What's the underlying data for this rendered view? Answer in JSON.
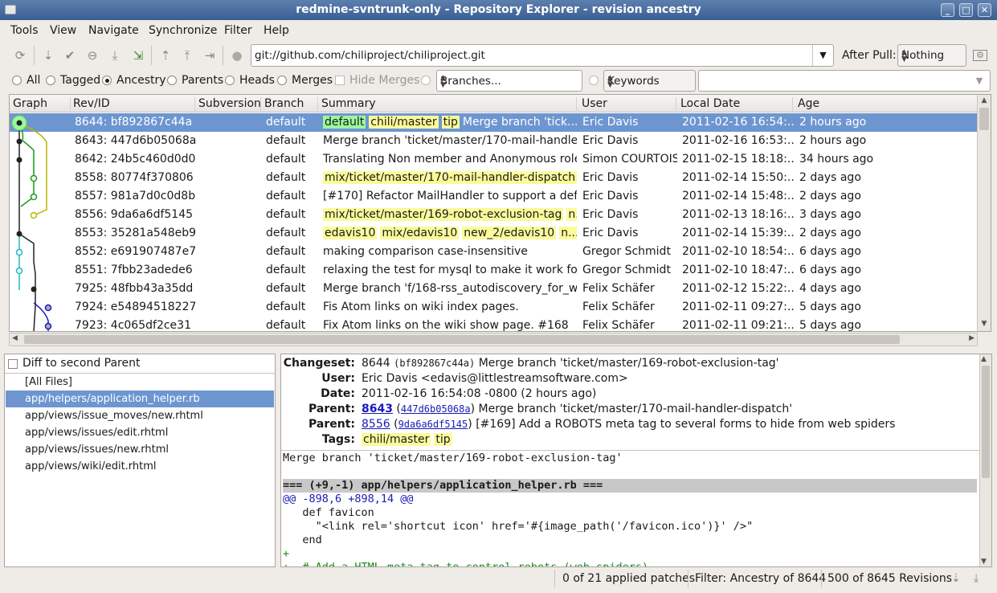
{
  "window": {
    "title": "redmine-svntrunk-only - Repository Explorer - revision ancestry",
    "min": "_",
    "max": "□",
    "close": "✕"
  },
  "menu": [
    "Tools",
    "View",
    "Navigate",
    "Synchronize",
    "Filter",
    "Help"
  ],
  "toolbar": {
    "url": "git://github.com/chiliproject/chiliproject.git",
    "after_pull_label": "After Pull:",
    "after_pull_value": "Nothing"
  },
  "filters": {
    "all": "All",
    "tagged": "Tagged",
    "ancestry": "Ancestry",
    "parents": "Parents",
    "heads": "Heads",
    "merges": "Merges",
    "hide_merges": "Hide Merges",
    "branches": "Branches...",
    "keywords": "Keywords",
    "selected_filter": "Ancestry"
  },
  "columns": [
    "Graph",
    "Rev/ID",
    "Subversion",
    "Branch",
    "Summary",
    "User",
    "Local Date",
    "Age"
  ],
  "rows": [
    {
      "rev": "8644: bf892867c44a",
      "branch": "default",
      "tags": [
        {
          "t": "default",
          "c": "g"
        },
        {
          "t": "chili/master",
          "c": "y"
        },
        {
          "t": "tip",
          "c": "y"
        }
      ],
      "summary": "Merge branch 'tick...",
      "user": "Eric Davis",
      "date": "2011-02-16 16:54:...",
      "age": "2 hours ago",
      "sel": true
    },
    {
      "rev": "8643: 447d6b05068a",
      "branch": "default",
      "tags": [],
      "summary": "Merge branch 'ticket/master/170-mail-handler...",
      "user": "Eric Davis",
      "date": "2011-02-16 16:53:...",
      "age": "2 hours ago"
    },
    {
      "rev": "8642: 24b5c460d0d0",
      "branch": "default",
      "tags": [],
      "summary": "Translating Non member and Anonymous role...",
      "user": "Simon COURTOIS",
      "date": "2011-02-15 18:18:...",
      "age": "34 hours ago"
    },
    {
      "rev": "8558: 80774f370806",
      "branch": "default",
      "tags": [
        {
          "t": "mix/ticket/master/170-mail-handler-dispatch ...",
          "c": "y"
        }
      ],
      "summary": "",
      "user": "Eric Davis",
      "date": "2011-02-14 15:50:...",
      "age": "2 days ago"
    },
    {
      "rev": "8557: 981a7d0c0d8b",
      "branch": "default",
      "tags": [],
      "summary": "[#170] Refactor MailHandler to support a defa...",
      "user": "Eric Davis",
      "date": "2011-02-14 15:48:...",
      "age": "2 days ago"
    },
    {
      "rev": "8556: 9da6a6df5145",
      "branch": "default",
      "tags": [
        {
          "t": "mix/ticket/master/169-robot-exclusion-tag",
          "c": "y"
        },
        {
          "t": "n...",
          "c": "y"
        }
      ],
      "summary": "",
      "user": "Eric Davis",
      "date": "2011-02-13 18:16:...",
      "age": "3 days ago"
    },
    {
      "rev": "8553: 35281a548eb9",
      "branch": "default",
      "tags": [
        {
          "t": "edavis10",
          "c": "y"
        },
        {
          "t": "mix/edavis10",
          "c": "y"
        },
        {
          "t": "new_2/edavis10",
          "c": "y"
        },
        {
          "t": "n...",
          "c": "y"
        }
      ],
      "summary": "",
      "user": "Eric Davis",
      "date": "2011-02-14 15:39:...",
      "age": "2 days ago"
    },
    {
      "rev": "8552: e691907487e7",
      "branch": "default",
      "tags": [],
      "summary": "making comparison case-insensitive",
      "user": "Gregor Schmidt",
      "date": "2011-02-10 18:54:...",
      "age": "6 days ago"
    },
    {
      "rev": "8551: 7fbb23adede6",
      "branch": "default",
      "tags": [],
      "summary": "relaxing the test for mysql to make it work fo...",
      "user": "Gregor Schmidt",
      "date": "2011-02-10 18:47:...",
      "age": "6 days ago"
    },
    {
      "rev": "7925: 48fbb43a35dd",
      "branch": "default",
      "tags": [],
      "summary": "Merge branch 'f/168-rss_autodiscovery_for_wi...",
      "user": "Felix Schäfer",
      "date": "2011-02-12 15:22:...",
      "age": "4 days ago"
    },
    {
      "rev": "7924: e54894518227",
      "branch": "default",
      "tags": [],
      "summary": "Fis Atom links on wiki index pages.",
      "user": "Felix Schäfer",
      "date": "2011-02-11 09:27:...",
      "age": "5 days ago"
    },
    {
      "rev": "7923: 4c065df2ce31",
      "branch": "default",
      "tags": [],
      "summary": "Fix Atom links on the wiki show page. #168",
      "user": "Felix Schäfer",
      "date": "2011-02-11 09:21:...",
      "age": "5 days ago"
    }
  ],
  "files": {
    "diff_label": "Diff to second Parent",
    "items": [
      "[All Files]",
      "app/helpers/application_helper.rb",
      "app/views/issue_moves/new.rhtml",
      "app/views/issues/edit.rhtml",
      "app/views/issues/new.rhtml",
      "app/views/wiki/edit.rhtml"
    ],
    "selected": 1
  },
  "detail": {
    "changeset_label": "Changeset:",
    "changeset_rev": "8644",
    "changeset_hash": "(bf892867c44a)",
    "changeset_msg": "Merge branch 'ticket/master/169-robot-exclusion-tag'",
    "user_label": "User:",
    "user": "Eric Davis <edavis@littlestreamsoftware.com>",
    "date_label": "Date:",
    "date": "2011-02-16 16:54:08 -0800 (2 hours ago)",
    "parent1_label": "Parent:",
    "parent1_rev": "8643",
    "parent1_hash": "447d6b05068a",
    "parent1_msg": "Merge branch 'ticket/master/170-mail-handler-dispatch'",
    "parent2_label": "Parent:",
    "parent2_rev": "8556",
    "parent2_hash": "9da6a6df5145",
    "parent2_msg": "[#169] Add a ROBOTS meta tag to several forms to hide from web spiders",
    "tags_label": "Tags:",
    "tags": [
      "chili/master",
      "tip"
    ]
  },
  "diff": [
    "Merge branch 'ticket/master/169-robot-exclusion-tag'",
    "",
    "=== (+9,-1) app/helpers/application_helper.rb ===",
    "@@ -898,6 +898,14 @@",
    "   def favicon",
    "     \"<link rel='shortcut icon' href='#{image_path('/favicon.ico')}' />\"",
    "   end",
    "+",
    "+  # Add a HTML meta tag to control robots (web spiders)"
  ],
  "status": {
    "patches": "0 of 21 applied patches",
    "filter": "Filter: Ancestry of 8644",
    "revisions": "500 of 8645 Revisions"
  }
}
